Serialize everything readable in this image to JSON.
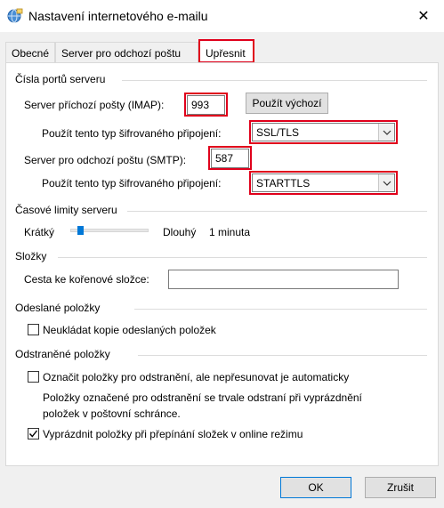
{
  "window": {
    "title": "Nastavení internetového e-mailu",
    "close_glyph": "✕"
  },
  "tabs": [
    {
      "label": "Obecné"
    },
    {
      "label": "Server pro odchozí poštu"
    },
    {
      "label": "Upřesnit"
    }
  ],
  "ports": {
    "group_title": "Čísla portů serveru",
    "imap_label": "Server příchozí pošty (IMAP):",
    "imap_value": "993",
    "default_button": "Použít výchozí",
    "incoming_encryption_label": "Použít tento typ šifrovaného připojení:",
    "incoming_encryption_value": "SSL/TLS",
    "smtp_label": "Server pro odchozí poštu (SMTP):",
    "smtp_value": "587",
    "outgoing_encryption_label": "Použít tento typ šifrovaného připojení:",
    "outgoing_encryption_value": "STARTTLS"
  },
  "timeouts": {
    "group_title": "Časové limity serveru",
    "short_label": "Krátký",
    "long_label": "Dlouhý",
    "value_text": "1 minuta",
    "slider_position": 0.1
  },
  "folders": {
    "group_title": "Složky",
    "root_label": "Cesta ke kořenové složce:",
    "root_value": ""
  },
  "sent": {
    "group_title": "Odeslané položky",
    "no_copy_label": "Neukládat kopie odeslaných položek",
    "no_copy_checked": false
  },
  "deleted": {
    "group_title": "Odstraněné položky",
    "mark_label": "Označit položky pro odstranění, ale nepřesunovat je automaticky",
    "mark_checked": false,
    "note_line1": "Položky označené pro odstranění se trvale odstraní při vyprázdnění",
    "note_line2": "položek v poštovní schránce.",
    "purge_label": "Vyprázdnit položky při přepínání složek v online režimu",
    "purge_checked": true
  },
  "footer": {
    "ok_label": "OK",
    "cancel_label": "Zrušit"
  },
  "colors": {
    "highlight": "#e0001b",
    "accent": "#0078d7"
  }
}
